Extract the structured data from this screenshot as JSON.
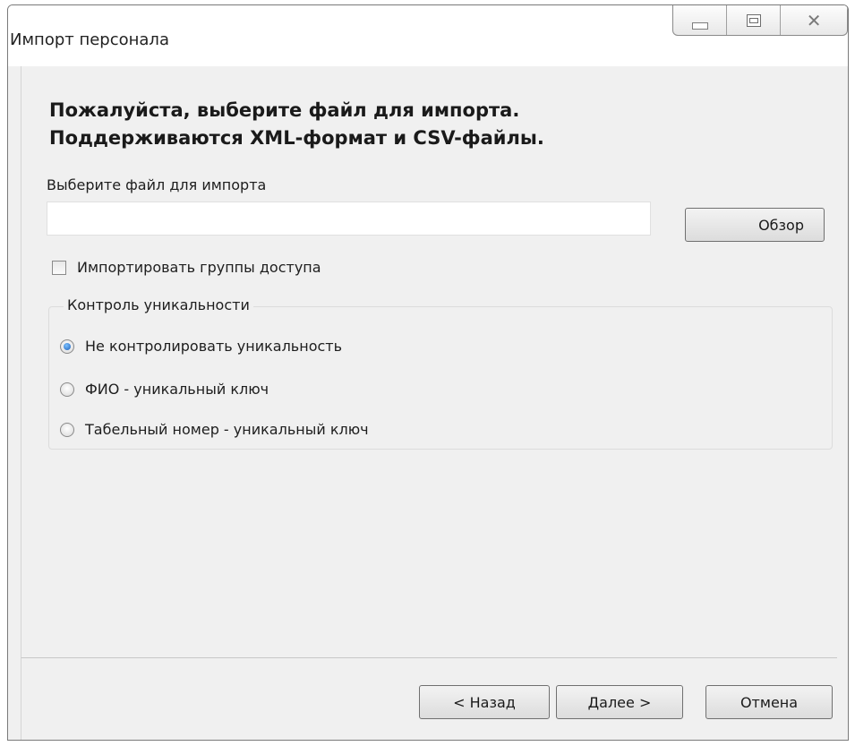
{
  "window": {
    "title": "Импорт персонала",
    "close_glyph": "✕"
  },
  "main": {
    "heading_line1": "Пожалуйста, выберите файл для импорта.",
    "heading_line2": "Поддерживаются XML-формат и CSV-файлы.",
    "file_label": "Выберите файл для импорта",
    "file_value": "",
    "browse_label": "Обзор",
    "import_groups_label": "Импортировать группы доступа",
    "import_groups_checked": false
  },
  "uniqueness": {
    "legend": "Контроль уникальности",
    "options": [
      {
        "label": "Не контролировать уникальность",
        "selected": true
      },
      {
        "label": "ФИО - уникальный ключ",
        "selected": false
      },
      {
        "label": "Табельный номер - уникальный ключ",
        "selected": false
      }
    ]
  },
  "footer": {
    "back_label": "< Назад",
    "next_label": "Далее >",
    "cancel_label": "Отмена"
  },
  "colors": {
    "dialog_bg": "#f0f0f0",
    "radio_selected": "#1d5fb8"
  }
}
